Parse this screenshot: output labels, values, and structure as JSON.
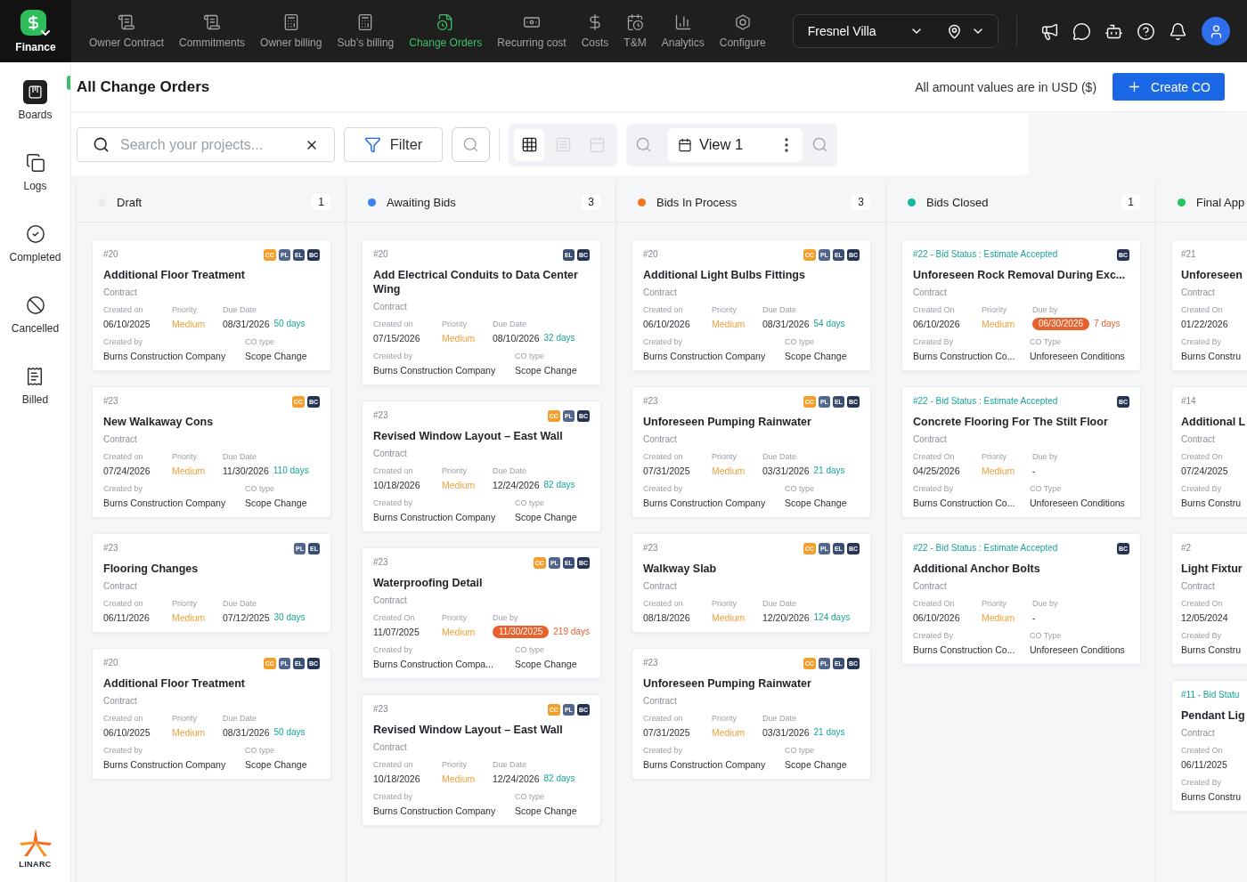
{
  "top_bar": {
    "module": "Finance",
    "nav": [
      {
        "label": "Owner Contract",
        "selected": false
      },
      {
        "label": "Commitments",
        "selected": false
      },
      {
        "label": "Owner billing",
        "selected": false
      },
      {
        "label": "Sub’s billing",
        "selected": false
      },
      {
        "label": "Change Orders",
        "selected": true
      },
      {
        "label": "Recurring cost",
        "selected": false
      },
      {
        "label": "Costs",
        "selected": false
      },
      {
        "label": "T&M",
        "selected": false
      },
      {
        "label": "Analytics",
        "selected": false
      },
      {
        "label": "Configure",
        "selected": false
      }
    ],
    "project": "Fresnel Villa"
  },
  "sidebar": {
    "items": [
      {
        "label": "Boards",
        "selected": true
      },
      {
        "label": "Logs",
        "selected": false
      },
      {
        "label": "Completed",
        "selected": false
      },
      {
        "label": "Cancelled",
        "selected": false
      },
      {
        "label": "Billed",
        "selected": false
      }
    ],
    "logo_text": "LINARC"
  },
  "header": {
    "title": "All Change Orders",
    "currency_note": "All amount values are in USD ($)",
    "create_label": "Create CO"
  },
  "toolbar": {
    "search": {
      "placeholder": "Search your projects..."
    },
    "filter_label": "Filter",
    "view_modes": [
      {
        "kind": "board",
        "selected": true
      },
      {
        "kind": "list",
        "selected": false
      },
      {
        "kind": "calendar",
        "selected": false
      }
    ],
    "saved_view": "View 1"
  },
  "board": {
    "columns": [
      {
        "title": "Draft",
        "count": "1",
        "color": "#e9ebef",
        "cards": [
          {
            "kind": "standard",
            "ref": "#20",
            "badges": [
              {
                "text": "CC",
                "color": "#f59e2b"
              },
              {
                "text": "PL",
                "color": "#52668c"
              },
              {
                "text": "EL",
                "color": "#3a4e74"
              },
              {
                "text": "BC",
                "color": "#243452"
              }
            ],
            "title": "Additional Floor Treatment",
            "subtitle": "Contract",
            "created_label": "Created on",
            "created": "06/10/2025",
            "priority_label": "Priority",
            "priority": "Medium",
            "due_label": "Due Date",
            "due": "08/31/2026",
            "days": "50 days",
            "overdue": false,
            "by_label": "Created by",
            "by": "Burns Construction Company",
            "type_label": "CO type",
            "type": "Scope Change"
          },
          {
            "kind": "standard",
            "ref": "#23",
            "badges": [
              {
                "text": "CC",
                "color": "#f59e2b"
              },
              {
                "text": "BC",
                "color": "#243452"
              }
            ],
            "title": "New Walkaway Cons",
            "subtitle": "Contract",
            "created_label": "Created on",
            "created": "07/24/2026",
            "priority_label": "Priority",
            "priority": "Medium",
            "due_label": "Due Date",
            "due": "11/30/2026",
            "days": "110 days",
            "overdue": false,
            "by_label": "Created by",
            "by": "Burns Construction Company",
            "type_label": "CO type",
            "type": "Scope Change"
          },
          {
            "kind": "standard",
            "ref": "#23",
            "badges": [
              {
                "text": "PL",
                "color": "#52668c"
              },
              {
                "text": "EL",
                "color": "#3a4e74"
              }
            ],
            "title": "Flooring Changes",
            "subtitle": "Contract",
            "created_label": "Created on",
            "created": "06/11/2026",
            "priority_label": "Priority",
            "priority": "Medium",
            "due_label": "Due Date",
            "due": "07/12/2025",
            "days": "30 days",
            "overdue": false
          },
          {
            "kind": "standard",
            "ref": "#20",
            "badges": [
              {
                "text": "CC",
                "color": "#f59e2b"
              },
              {
                "text": "PL",
                "color": "#52668c"
              },
              {
                "text": "EL",
                "color": "#3a4e74"
              },
              {
                "text": "BC",
                "color": "#243452"
              }
            ],
            "title": "Additional Floor Treatment",
            "subtitle": "Contract",
            "created_label": "Created on",
            "created": "06/10/2025",
            "priority_label": "Priority",
            "priority": "Medium",
            "due_label": "Due Date",
            "due": "08/31/2026",
            "days": "50 days",
            "overdue": false,
            "by_label": "Created by",
            "by": "Burns Construction Company",
            "type_label": "CO type",
            "type": "Scope Change"
          }
        ]
      },
      {
        "title": "Awaiting Bids",
        "count": "3",
        "color": "#3b82f6",
        "cards": [
          {
            "kind": "standard",
            "ref": "#20",
            "badges": [
              {
                "text": "EL",
                "color": "#3a4e74"
              },
              {
                "text": "BC",
                "color": "#243452"
              }
            ],
            "title": "Add Electrical Conduits to Data Center Wing",
            "subtitle": "Contract",
            "created_label": "Created on",
            "created": "07/15/2026",
            "priority_label": "Priority",
            "priority": "Medium",
            "due_label": "Due Date",
            "due": "08/10/2026",
            "days": "32 days",
            "overdue": false,
            "by_label": "Created by",
            "by": "Burns Construction Company",
            "type_label": "CO type",
            "type": "Scope Change"
          },
          {
            "kind": "standard",
            "ref": "#23",
            "badges": [
              {
                "text": "CC",
                "color": "#f59e2b"
              },
              {
                "text": "PL",
                "color": "#52668c"
              },
              {
                "text": "BC",
                "color": "#243452"
              }
            ],
            "title": "Revised Window Layout – East Wall",
            "subtitle": "Contract",
            "created_label": "Created on",
            "created": "10/18/2026",
            "priority_label": "Priority",
            "priority": "Medium",
            "due_label": "Due Date",
            "due": "12/24/2026",
            "days": "82 days",
            "overdue": false,
            "by_label": "Created by",
            "by": "Burns Construction Company",
            "type_label": "CO type",
            "type": "Scope Change"
          },
          {
            "kind": "standard",
            "ref": "#23",
            "badges": [
              {
                "text": "CC",
                "color": "#f59e2b"
              },
              {
                "text": "PL",
                "color": "#52668c"
              },
              {
                "text": "EL",
                "color": "#3a4e74"
              },
              {
                "text": "BC",
                "color": "#243452"
              }
            ],
            "title": "Waterproofing Detail",
            "subtitle": "Contract",
            "created_label": "Created On",
            "created": "11/07/2025",
            "priority_label": "Priority",
            "priority": "Medium",
            "due_label": "Due by",
            "due": "11/30/2025",
            "days": "219 days",
            "overdue": true,
            "by_label": "Created by",
            "by": "Burns Construction Compa...",
            "type_label": "CO type",
            "type": "Scope Change"
          },
          {
            "kind": "standard",
            "ref": "#23",
            "badges": [
              {
                "text": "CC",
                "color": "#f59e2b"
              },
              {
                "text": "PL",
                "color": "#52668c"
              },
              {
                "text": "BC",
                "color": "#243452"
              }
            ],
            "title": "Revised Window Layout – East Wall",
            "subtitle": "Contract",
            "created_label": "Created on",
            "created": "10/18/2026",
            "priority_label": "Priority",
            "priority": "Medium",
            "due_label": "Due Date",
            "due": "12/24/2026",
            "days": "82 days",
            "overdue": false,
            "by_label": "Created by",
            "by": "Burns Construction Company",
            "type_label": "CO type",
            "type": "Scope Change"
          }
        ]
      },
      {
        "title": "Bids In Process",
        "count": "3",
        "color": "#f47521",
        "cards": [
          {
            "kind": "standard",
            "ref": "#20",
            "badges": [
              {
                "text": "CC",
                "color": "#f59e2b"
              },
              {
                "text": "PL",
                "color": "#52668c"
              },
              {
                "text": "EL",
                "color": "#3a4e74"
              },
              {
                "text": "BC",
                "color": "#243452"
              }
            ],
            "title": "Additional Light Bulbs Fittings",
            "subtitle": "Contract",
            "created_label": "Created on",
            "created": "06/10/2026",
            "priority_label": "Priority",
            "priority": "Medium",
            "due_label": "Due Date",
            "due": "08/31/2026",
            "days": "54 days",
            "overdue": false,
            "by_label": "Created by",
            "by": "Burns Construction Company",
            "type_label": "CO type",
            "type": "Scope Change"
          },
          {
            "kind": "standard",
            "ref": "#23",
            "badges": [
              {
                "text": "CC",
                "color": "#f59e2b"
              },
              {
                "text": "PL",
                "color": "#52668c"
              },
              {
                "text": "EL",
                "color": "#3a4e74"
              },
              {
                "text": "BC",
                "color": "#243452"
              }
            ],
            "title": "Unforeseen Pumping Rainwater",
            "subtitle": "Contract",
            "created_label": "Created on",
            "created": "07/31/2025",
            "priority_label": "Priority",
            "priority": "Medium",
            "due_label": "Due Date",
            "due": "03/31/2026",
            "days": "21 days",
            "overdue": false,
            "by_label": "Created by",
            "by": "Burns Construction Company",
            "type_label": "CO type",
            "type": "Scope Change"
          },
          {
            "kind": "standard",
            "ref": "#23",
            "badges": [
              {
                "text": "CC",
                "color": "#f59e2b"
              },
              {
                "text": "PL",
                "color": "#52668c"
              },
              {
                "text": "EL",
                "color": "#3a4e74"
              },
              {
                "text": "BC",
                "color": "#243452"
              }
            ],
            "title": "Walkway Slab",
            "subtitle": "Contract",
            "created_label": "Created on",
            "created": "08/18/2026",
            "priority_label": "Priority",
            "priority": "Medium",
            "due_label": "Due Date",
            "due": "12/20/2026",
            "days": "124 days",
            "overdue": false
          },
          {
            "kind": "standard",
            "ref": "#23",
            "badges": [
              {
                "text": "CC",
                "color": "#f59e2b"
              },
              {
                "text": "PL",
                "color": "#52668c"
              },
              {
                "text": "EL",
                "color": "#3a4e74"
              },
              {
                "text": "BC",
                "color": "#243452"
              }
            ],
            "title": "Unforeseen Pumping Rainwater",
            "subtitle": "Contract",
            "created_label": "Created on",
            "created": "07/31/2025",
            "priority_label": "Priority",
            "priority": "Medium",
            "due_label": "Due Date",
            "due": "03/31/2026",
            "days": "21 days",
            "overdue": false,
            "by_label": "Created by",
            "by": "Burns Construction Company",
            "type_label": "CO type",
            "type": "Scope Change"
          }
        ]
      },
      {
        "title": "Bids Closed",
        "count": "1",
        "color": "#14b8a0",
        "cards": [
          {
            "kind": "bid_status",
            "ref": "#22 - Bid Status : Estimate Accepted",
            "badges": [
              {
                "text": "BC",
                "color": "#243452"
              }
            ],
            "title": "Unforeseen Rock Removal During Exc...",
            "subtitle": "Contract",
            "created_label": "Created On",
            "created": "06/10/2026",
            "priority_label": "Priority",
            "priority": "Medium",
            "due_label": "Due by",
            "due": "06/30/2026",
            "days": "7 days",
            "overdue": true,
            "by_label": "Created By",
            "by": "Burns Construction Co...",
            "type_label": "CO Type",
            "type": "Unforeseen Conditions"
          },
          {
            "kind": "bid_status",
            "ref": "#22 - Bid Status : Estimate Accepted",
            "badges": [
              {
                "text": "BC",
                "color": "#243452"
              }
            ],
            "title": "Concrete Flooring For The Stilt Floor",
            "subtitle": "Contract",
            "created_label": "Created On",
            "created": "04/25/2026",
            "priority_label": "Priority",
            "priority": "Medium",
            "due_label": "Due by",
            "due": "-",
            "overdue": false,
            "by_label": "Created By",
            "by": "Burns Construction Co...",
            "type_label": "CO Type",
            "type": "Unforeseen Conditions"
          },
          {
            "kind": "bid_status",
            "ref": "#22 - Bid Status : Estimate Accepted",
            "badges": [
              {
                "text": "BC",
                "color": "#243452"
              }
            ],
            "title": "Additional Anchor Bolts",
            "subtitle": "Contract",
            "created_label": "Created On",
            "created": "06/10/2026",
            "priority_label": "Priority",
            "priority": "Medium",
            "due_label": "Due by",
            "due": "-",
            "overdue": false,
            "by_label": "Created By",
            "by": "Burns Construction Co...",
            "type_label": "CO Type",
            "type": "Unforeseen Conditions"
          }
        ]
      },
      {
        "title": "Final App",
        "color": "#22c55e",
        "cards": [
          {
            "kind": "standard",
            "ref": "#21",
            "title": "Unforeseen",
            "subtitle": "Contract",
            "created_label": "Created On",
            "created": "01/22/2026",
            "by_label": "Created By",
            "by": "Burns Constru"
          },
          {
            "kind": "standard",
            "ref": "#14",
            "title": "Additional L",
            "subtitle": "Contract",
            "created_label": "Created On",
            "created": "07/24/2025",
            "by_label": "Created By",
            "by": "Burns Constru"
          },
          {
            "kind": "standard",
            "ref": "#2",
            "title": "Light Fixtur",
            "subtitle": "Contract",
            "created_label": "Created On",
            "created": "12/05/2024",
            "by_label": "Created By",
            "by": "Burns Constru"
          },
          {
            "kind": "bid_status",
            "ref": "#11 - Bid Statu",
            "title": "Pendant Lig",
            "subtitle": "Contract",
            "created_label": "Created On",
            "created": "06/11/2025",
            "by_label": "Created By",
            "by": "Burns Constru"
          }
        ]
      }
    ]
  }
}
